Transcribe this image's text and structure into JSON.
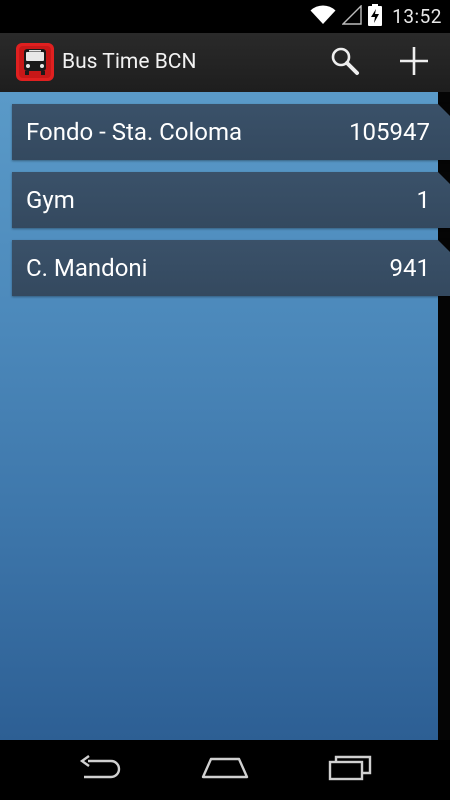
{
  "status_bar": {
    "time": "13:52",
    "icons": [
      "wifi-icon",
      "signal-icon",
      "battery-charging-icon"
    ]
  },
  "action_bar": {
    "title": "Bus Time BCN",
    "app_icon": "bus-icon",
    "actions": [
      {
        "name": "search",
        "icon": "search-icon"
      },
      {
        "name": "add",
        "icon": "plus-icon"
      }
    ]
  },
  "stops": [
    {
      "name": "Fondo - Sta. Coloma",
      "code": "105947"
    },
    {
      "name": "Gym",
      "code": "1"
    },
    {
      "name": "C. Mandoni",
      "code": "941"
    }
  ],
  "nav_bar": {
    "buttons": [
      "back-icon",
      "home-icon",
      "recent-apps-icon"
    ]
  },
  "colors": {
    "accent_red": "#e02020",
    "row_bg": "#34495f",
    "panel_top": "#5a9ac8",
    "panel_bottom": "#2d5f94"
  }
}
